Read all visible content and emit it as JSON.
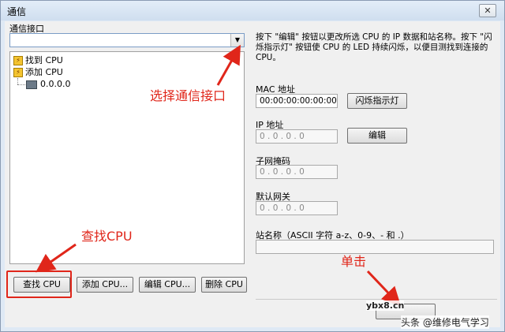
{
  "window": {
    "title": "通信",
    "close_symbol": "✕"
  },
  "left": {
    "interface_label": "通信接口",
    "interface_value": "",
    "tree": [
      "找到 CPU",
      "添加 CPU",
      "0.0.0.0"
    ],
    "buttons": [
      "查找 CPU",
      "添加 CPU...",
      "编辑 CPU...",
      "删除 CPU"
    ]
  },
  "right": {
    "description": "按下 \"编辑\" 按钮以更改所选 CPU 的 IP 数据和站名称。按下 \"闪烁指示灯\" 按钮使 CPU 的 LED 持续闪烁，以便目测找到连接的 CPU。",
    "mac_label": "MAC 地址",
    "mac_value": "00:00:00:00:00:00",
    "blink_button": "闪烁指示灯",
    "ip_label": "IP 地址",
    "ip_value": "0 . 0 . 0 . 0",
    "edit_button": "编辑",
    "subnet_label": "子网掩码",
    "subnet_value": "0 . 0 . 0 . 0",
    "gateway_label": "默认网关",
    "gateway_value": "0 . 0 . 0 . 0",
    "station_label": "站名称（ASCII 字符 a-z、0-9、- 和 .）",
    "station_value": ""
  },
  "annotations": {
    "select_interface": "选择通信接口",
    "find_cpu": "查找CPU",
    "click": "单击"
  },
  "watermark": {
    "site": "ybx8.cn",
    "brand": "头条 @维修电气学习"
  },
  "colors": {
    "annotation": "#e0261a",
    "combo_border": "#7a9cc6"
  },
  "icons": [
    "close-icon",
    "chevron-down-icon",
    "lightning-icon",
    "network-card-icon",
    "red-arrow-icon"
  ]
}
